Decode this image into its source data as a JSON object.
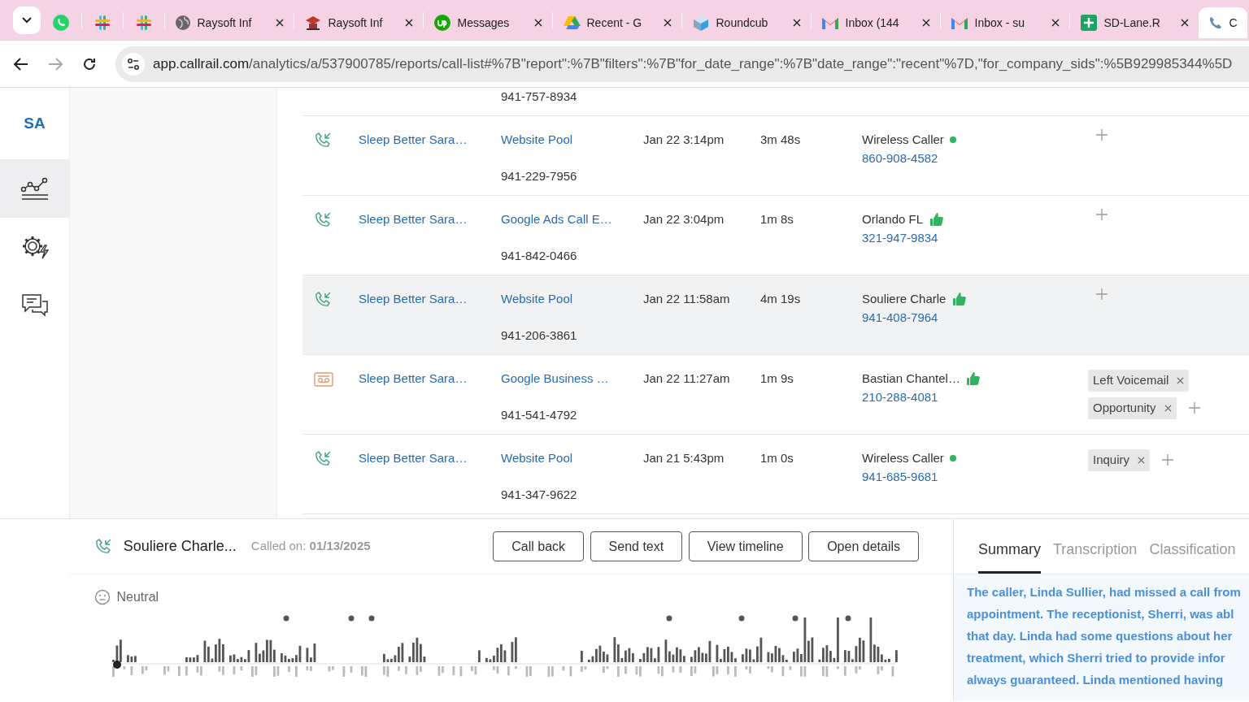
{
  "browser": {
    "tabs": [
      {
        "kind": "pinned",
        "selected": false
      },
      {
        "kind": "pinned",
        "selected": false
      },
      {
        "kind": "pinned",
        "selected": false
      },
      {
        "kind": "normal",
        "title": "Raysoft Inf",
        "selected": false
      },
      {
        "kind": "normal",
        "title": "Raysoft Inf",
        "selected": false
      },
      {
        "kind": "normal",
        "title": "Messages",
        "selected": false
      },
      {
        "kind": "normal",
        "title": "Recent - G",
        "selected": false
      },
      {
        "kind": "normal",
        "title": "Roundcub",
        "selected": false
      },
      {
        "kind": "normal",
        "title": "Inbox (144",
        "selected": false
      },
      {
        "kind": "normal",
        "title": "Inbox - su",
        "selected": false
      },
      {
        "kind": "normal",
        "title": "SD-Lane.R",
        "selected": false
      },
      {
        "kind": "normal",
        "title": "C",
        "selected": true
      }
    ],
    "url_host": "app.callrail.com",
    "url_path": "/analytics/a/537900785/reports/call-list#%7B\"report\":%7B\"filters\":%7B\"for_date_range\":%7B\"date_range\":\"recent\"%7D,\"for_company_sids\":%5B929985344%5D"
  },
  "sidebar": {
    "account": "SA",
    "items": [
      {
        "kind": "reports",
        "selected": true
      },
      {
        "kind": "settings",
        "selected": false
      },
      {
        "kind": "messages",
        "selected": false
      }
    ]
  },
  "calls": {
    "partial_row_tracking": "941-757-8934",
    "rows": [
      {
        "kind": "inbound",
        "company": "Sleep Better Sara…",
        "source": "Website Pool",
        "tracking": "941-229-7956",
        "date": "Jan 22 3:14pm",
        "duration": "3m 48s",
        "caller": "Wireless Caller",
        "caller_badge": {
          "kind": "dot"
        },
        "phone": "860-908-4582",
        "tags": [],
        "selected": false
      },
      {
        "kind": "inbound",
        "company": "Sleep Better Sara…",
        "source": "Google Ads Call E…",
        "tracking": "941-842-0466",
        "date": "Jan 22 3:04pm",
        "duration": "1m 8s",
        "caller": "Orlando FL",
        "caller_badge": {
          "kind": "thumb"
        },
        "phone": "321-947-9834",
        "tags": [],
        "selected": false
      },
      {
        "kind": "inbound",
        "company": "Sleep Better Sara…",
        "source": "Website Pool",
        "tracking": "941-206-3861",
        "date": "Jan 22 11:58am",
        "duration": "4m 19s",
        "caller": "Souliere Charle",
        "caller_badge": {
          "kind": "thumb"
        },
        "phone": "941-408-7964",
        "tags": [],
        "selected": true
      },
      {
        "kind": "voicemail",
        "company": "Sleep Better Sara…",
        "source": "Google Business …",
        "tracking": "941-541-4792",
        "date": "Jan 22 11:27am",
        "duration": "1m 9s",
        "caller": "Bastian Chantel…",
        "caller_badge": {
          "kind": "thumb"
        },
        "phone": "210-288-4081",
        "tags": [
          "Left Voicemail",
          "Opportunity"
        ],
        "selected": false
      },
      {
        "kind": "inbound",
        "company": "Sleep Better Sara…",
        "source": "Website Pool",
        "tracking": "941-347-9622",
        "date": "Jan 21 5:43pm",
        "duration": "1m 0s",
        "caller": "Wireless Caller",
        "caller_badge": {
          "kind": "dot"
        },
        "phone": "941-685-9681",
        "tags": [
          "Inquiry"
        ],
        "selected": false
      }
    ]
  },
  "detail": {
    "caller": "Souliere Charle...",
    "called_on": "Called on: **01/13/2025**",
    "buttons": [
      "Call back",
      "Send text",
      "View timeline",
      "Open details"
    ],
    "sentiment": "Neutral",
    "tabs": [
      {
        "label": "Summary",
        "selected": true
      },
      {
        "label": "Transcription",
        "selected": false
      },
      {
        "label": "Classification",
        "selected": false
      }
    ],
    "summary_lines": [
      "The caller, Linda Sullier, had missed a call from",
      "appointment. The receptionist, Sherri, was abl",
      "that day. Linda had some questions about her",
      "treatment, which Sherri tried to provide infor",
      "always guaranteed. Linda mentioned having"
    ]
  }
}
